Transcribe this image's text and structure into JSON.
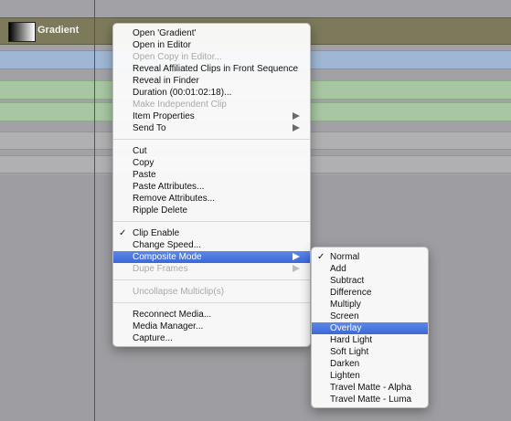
{
  "timeline": {
    "clip_name": "Gradient"
  },
  "context_menu": {
    "groups": [
      [
        {
          "label": "Open 'Gradient'"
        },
        {
          "label": "Open in Editor"
        },
        {
          "label": "Open Copy in Editor..."
        },
        {
          "label": "Reveal Affiliated Clips in Front Sequence"
        },
        {
          "label": "Reveal in Finder"
        },
        {
          "label": "Duration (00:01:02:18)..."
        },
        {
          "label": "Make Independent Clip"
        },
        {
          "label": "Item Properties"
        },
        {
          "label": "Send To"
        }
      ],
      [
        {
          "label": "Cut"
        },
        {
          "label": "Copy"
        },
        {
          "label": "Paste"
        },
        {
          "label": "Paste Attributes..."
        },
        {
          "label": "Remove Attributes..."
        },
        {
          "label": "Ripple Delete"
        }
      ],
      [
        {
          "label": "Clip Enable",
          "checked": true
        },
        {
          "label": "Change Speed..."
        },
        {
          "label": "Composite Mode",
          "highlighted": true
        },
        {
          "label": "Dupe Frames"
        }
      ],
      [
        {
          "label": "Uncollapse Multiclip(s)"
        }
      ],
      [
        {
          "label": "Reconnect Media..."
        },
        {
          "label": "Media Manager..."
        },
        {
          "label": "Capture..."
        }
      ]
    ],
    "check_mark": "✓"
  },
  "composite_submenu": {
    "items": [
      {
        "label": "Normal",
        "checked": true
      },
      {
        "label": "Add"
      },
      {
        "label": "Subtract"
      },
      {
        "label": "Difference"
      },
      {
        "label": "Multiply"
      },
      {
        "label": "Screen"
      },
      {
        "label": "Overlay",
        "highlighted": true
      },
      {
        "label": "Hard Light"
      },
      {
        "label": "Soft Light"
      },
      {
        "label": "Darken"
      },
      {
        "label": "Lighten"
      },
      {
        "label": "Travel Matte - Alpha"
      },
      {
        "label": "Travel Matte - Luma"
      }
    ]
  },
  "colors": {
    "highlight": "#3c68d8",
    "gradient_track": "#7c7a5a",
    "video_track": "#9fb6d4",
    "audio_track": "#a7c6a2"
  }
}
